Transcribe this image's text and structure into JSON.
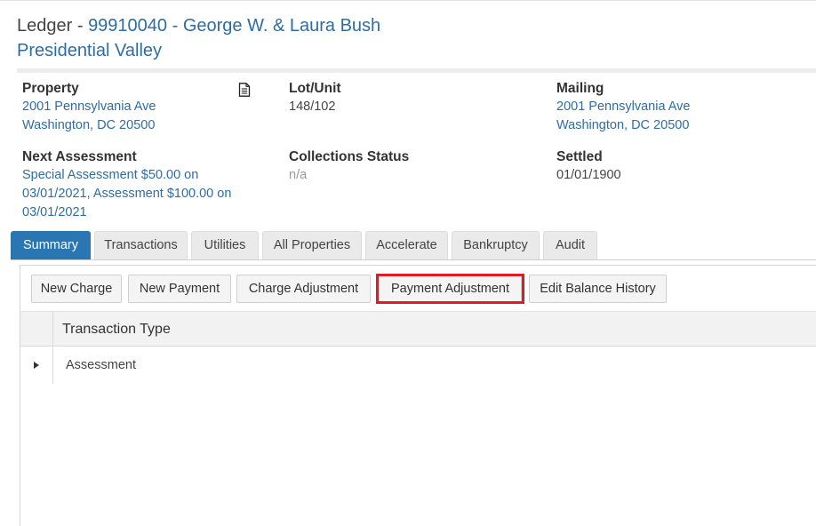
{
  "header": {
    "title_prefix": "Ledger - ",
    "title_link": "99910040 - George W. & Laura Bush",
    "subtitle": "Presidential Valley"
  },
  "info": {
    "property": {
      "label": "Property",
      "line1": "2001 Pennsylvania Ave",
      "line2": "Washington, DC 20500",
      "icon": "document-icon"
    },
    "lot_unit": {
      "label": "Lot/Unit",
      "value": "148/102"
    },
    "mailing": {
      "label": "Mailing",
      "line1": "2001 Pennsylvania Ave",
      "line2": "Washington, DC 20500"
    },
    "next_assessment": {
      "label": "Next Assessment",
      "line1": "Special Assessment $50.00 on",
      "line2": "03/01/2021, Assessment $100.00 on",
      "line3": "03/01/2021"
    },
    "collections_status": {
      "label": "Collections Status",
      "value": "n/a"
    },
    "settled": {
      "label": "Settled",
      "value": "01/01/1900"
    }
  },
  "tabs": [
    {
      "label": "Summary",
      "active": true
    },
    {
      "label": "Transactions"
    },
    {
      "label": "Utilities"
    },
    {
      "label": "All Properties"
    },
    {
      "label": "Accelerate"
    },
    {
      "label": "Bankruptcy"
    },
    {
      "label": "Audit"
    }
  ],
  "toolbar": {
    "new_charge": "New Charge",
    "new_payment": "New Payment",
    "charge_adjustment": "Charge Adjustment",
    "payment_adjustment": "Payment Adjustment",
    "edit_balance_history": "Edit Balance History"
  },
  "grid": {
    "header": "Transaction Type",
    "rows": [
      {
        "type": "Assessment"
      }
    ]
  },
  "colors": {
    "link": "#2e6da4",
    "active_tab": "#2a76b3",
    "highlight": "#e01b24"
  }
}
